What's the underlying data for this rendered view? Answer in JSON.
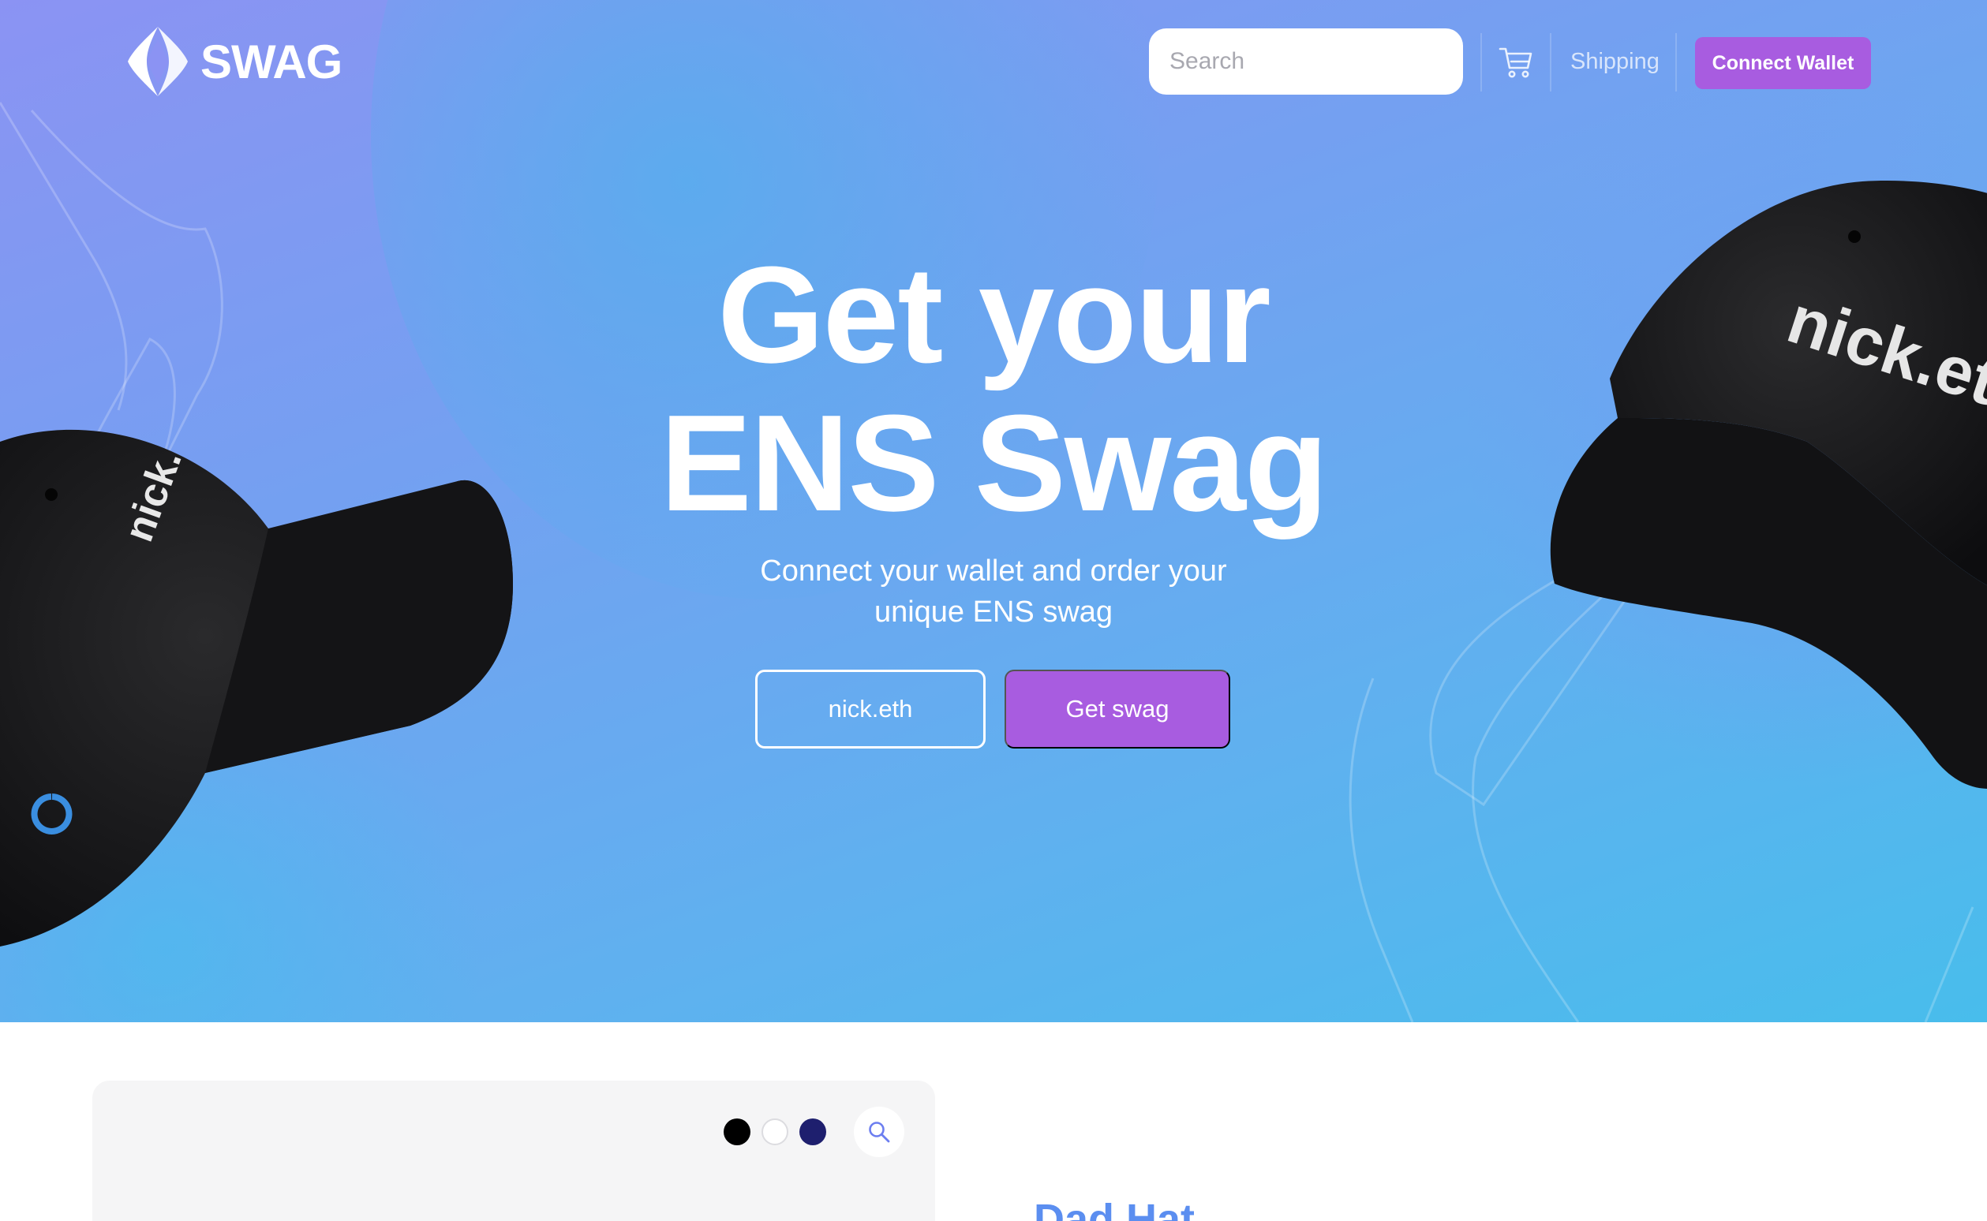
{
  "header": {
    "logo_text": "SWAG",
    "search_placeholder": "Search",
    "shipping_label": "Shipping",
    "connect_wallet_label": "Connect Wallet"
  },
  "hero": {
    "headline_line1": "Get your",
    "headline_line2": "ENS Swag",
    "subtitle_line1": "Connect your wallet and order your",
    "subtitle_line2": "unique ENS swag",
    "name_value": "nick.eth",
    "cta_label": "Get swag",
    "hat_left_text": "nick.",
    "hat_right_text": "nick.et"
  },
  "product": {
    "title": "Dad Hat",
    "swatches": [
      "#000000",
      "#ffffff",
      "#1e1f6e"
    ]
  },
  "colors": {
    "accent": "#a85ce0",
    "title_blue": "#5b8ef0",
    "card_bg": "#f5f5f6"
  },
  "icons": [
    "ens-logo-icon",
    "cart-icon",
    "search-zoom-icon"
  ]
}
